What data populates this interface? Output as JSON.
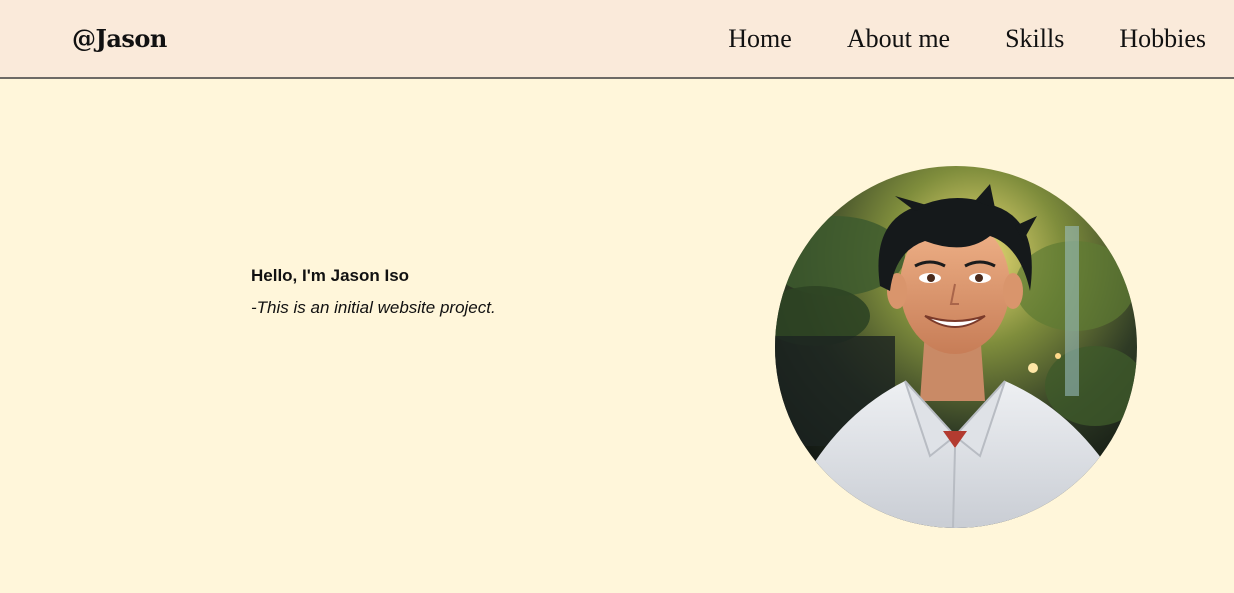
{
  "header": {
    "brand": "@Jason",
    "nav": [
      {
        "label": "Home"
      },
      {
        "label": "About me"
      },
      {
        "label": "Skills"
      },
      {
        "label": "Hobbies"
      }
    ]
  },
  "hero": {
    "title": "Hello, I'm Jason Iso",
    "subtitle": "-This is an initial website project."
  },
  "colors": {
    "page_background": "#fff6da",
    "navbar_background": "#faeada",
    "navbar_border": "#6d6a66",
    "text": "#111111"
  }
}
